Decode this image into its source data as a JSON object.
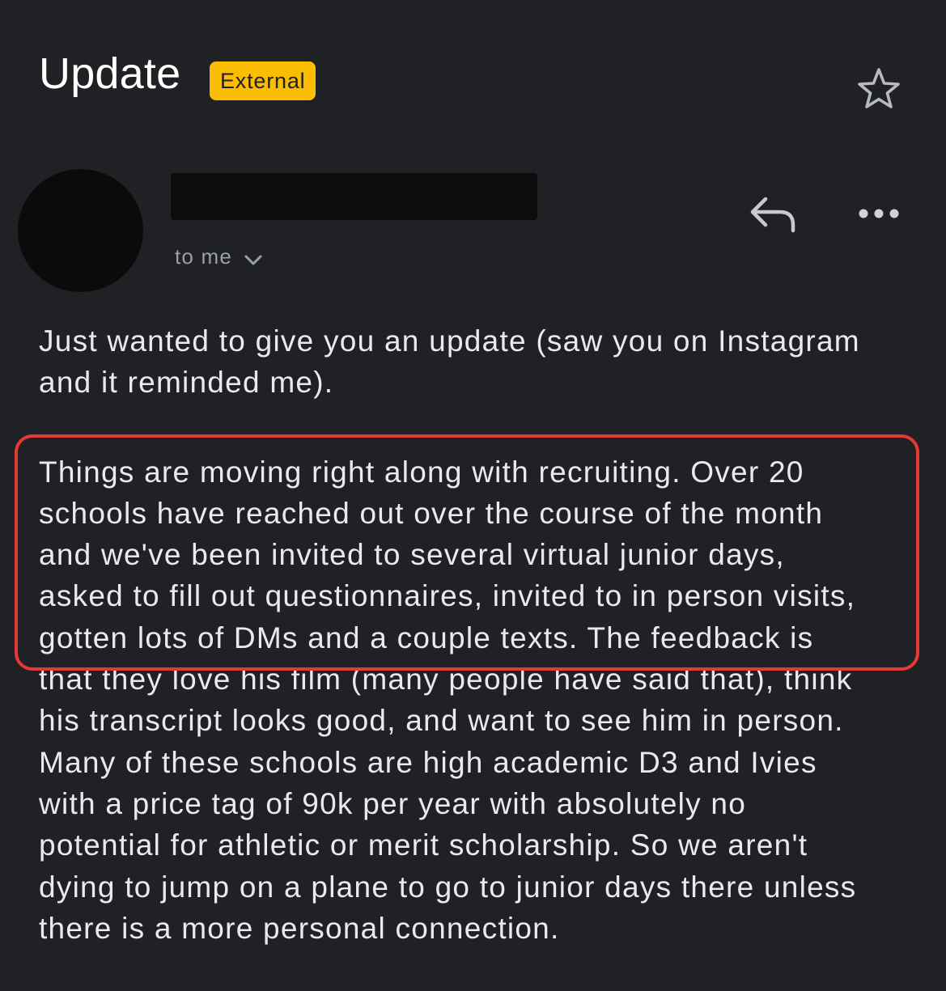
{
  "header": {
    "subject": "Update",
    "badge": "External",
    "star_icon": "star-outline-icon"
  },
  "sender": {
    "avatar": "avatar-redacted",
    "name_redacted": true,
    "recipient_label": "to me",
    "recipient_chevron_icon": "chevron-down-icon"
  },
  "actions": {
    "reply_icon": "reply-icon",
    "more_icon": "more-horizontal-icon"
  },
  "message": {
    "paragraph1": [
      "Just wanted to give you an update (saw you on Instagram",
      "and it reminded me)."
    ],
    "paragraph2": [
      "Things are moving right along with recruiting. Over 20",
      "schools have reached out over the course of the month",
      "and we've been invited to several virtual junior days,",
      "asked to fill out questionnaires, invited to in person visits,",
      "gotten lots of DMs and a couple texts.  The feedback is",
      "that they love his film (many people have said that), think",
      "his transcript looks good, and want to see him in person.",
      "Many of these schools are high academic D3 and Ivies",
      "with a price tag of 90k per year with absolutely no",
      "potential for athletic or merit scholarship. So we aren't",
      "dying to jump on a plane to go to junior days there unless",
      "there is a more personal connection."
    ]
  },
  "colors": {
    "background": "#202124",
    "badge": "#fbbc04",
    "highlight_border": "#e53935",
    "secondary_text": "#9aa0a6"
  }
}
